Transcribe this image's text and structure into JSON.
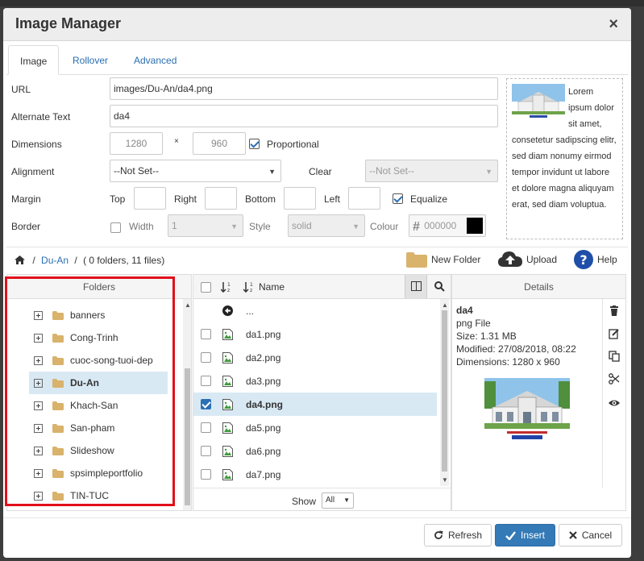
{
  "dialog": {
    "title": "Image Manager",
    "close_glyph": "×"
  },
  "tabs": [
    {
      "label": "Image",
      "active": true
    },
    {
      "label": "Rollover",
      "active": false
    },
    {
      "label": "Advanced",
      "active": false
    }
  ],
  "form": {
    "url": {
      "label": "URL",
      "value": "images/Du-An/da4.png"
    },
    "alt": {
      "label": "Alternate Text",
      "value": "da4"
    },
    "dimensions": {
      "label": "Dimensions",
      "width": "1280",
      "times": "×",
      "height": "960",
      "proportional_label": "Proportional",
      "proportional_checked": true
    },
    "alignment": {
      "label": "Alignment",
      "value": "--Not Set--",
      "clear_label": "Clear",
      "clear_value": "--Not Set--"
    },
    "margin": {
      "label": "Margin",
      "top": "Top",
      "right": "Right",
      "bottom": "Bottom",
      "left": "Left",
      "equalize_label": "Equalize",
      "equalize_checked": true
    },
    "border": {
      "label": "Border",
      "width_label": "Width",
      "width_value": "1",
      "style_label": "Style",
      "style_value": "solid",
      "colour_label": "Colour",
      "colour_hash": "#",
      "colour_value": "000000",
      "colour_swatch": "#000000"
    }
  },
  "preview": {
    "text": "Lorem ipsum dolor sit amet, consetetur sadipscing elitr, sed diam nonumy eirmod tempor invidunt ut labore et dolore magna aliquyam erat, sed diam voluptua."
  },
  "browser": {
    "crumb_sep": "/",
    "crumb_folder": "Du-An",
    "crumb_info": "( 0 folders, 11 files)",
    "new_folder": "New Folder",
    "upload": "Upload",
    "help": "Help"
  },
  "folders_panel": {
    "header": "Folders",
    "items": [
      {
        "name": "banners",
        "active": false
      },
      {
        "name": "Cong-Trinh",
        "active": false
      },
      {
        "name": "cuoc-song-tuoi-dep",
        "active": false
      },
      {
        "name": "Du-An",
        "active": true
      },
      {
        "name": "Khach-San",
        "active": false
      },
      {
        "name": "San-pham",
        "active": false
      },
      {
        "name": "Slideshow",
        "active": false
      },
      {
        "name": "spsimpleportfolio",
        "active": false
      },
      {
        "name": "TIN-TUC",
        "active": false
      }
    ]
  },
  "files_panel": {
    "name_col": "Name",
    "parent": "...",
    "files": [
      {
        "name": "da1.png",
        "selected": false
      },
      {
        "name": "da2.png",
        "selected": false
      },
      {
        "name": "da3.png",
        "selected": false
      },
      {
        "name": "da4.png",
        "selected": true
      },
      {
        "name": "da5.png",
        "selected": false
      },
      {
        "name": "da6.png",
        "selected": false
      },
      {
        "name": "da7.png",
        "selected": false
      }
    ],
    "show_label": "Show",
    "show_value": "All"
  },
  "details_panel": {
    "header": "Details",
    "name": "da4",
    "type": "png File",
    "size": "Size: 1.31 MB",
    "modified": "Modified: 27/08/2018, 08:22",
    "dimensions": "Dimensions: 1280 x 960"
  },
  "footer": {
    "refresh": "Refresh",
    "insert": "Insert",
    "cancel": "Cancel"
  },
  "colors": {
    "link": "#2a6fb0",
    "primary": "#337ab7",
    "highlight": "#d9e9f4",
    "annotation": "#e0101a",
    "folder": "#d9b26b"
  }
}
